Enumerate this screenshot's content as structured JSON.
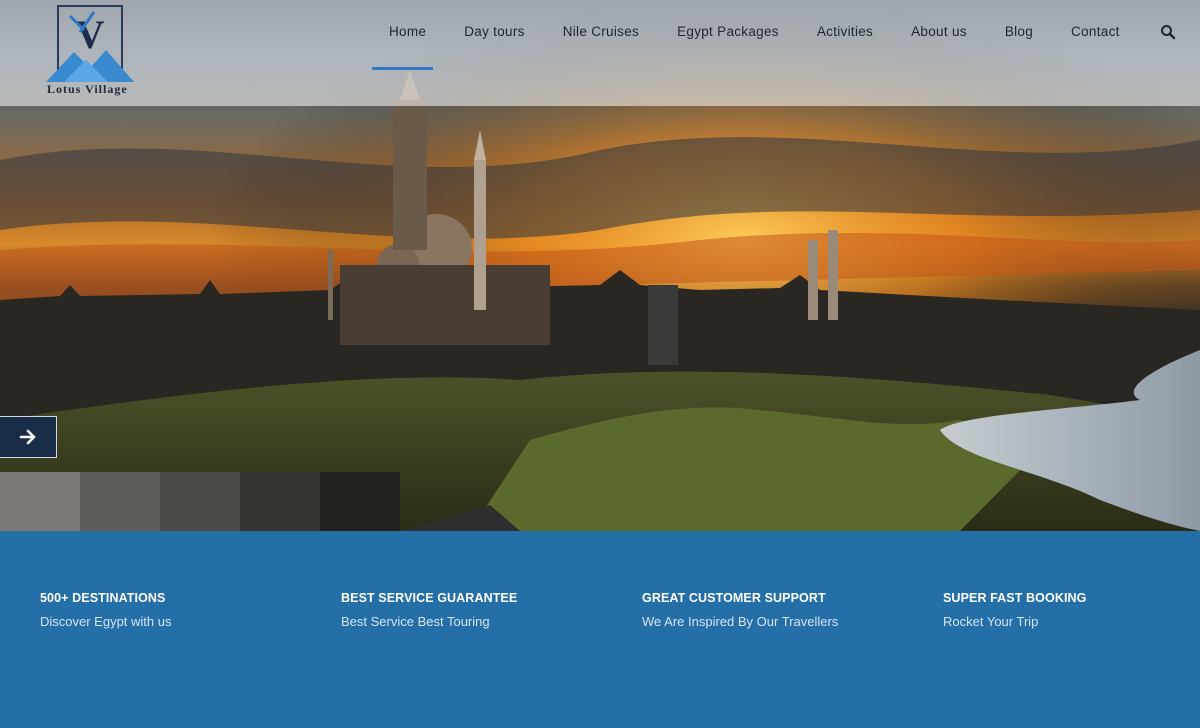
{
  "brand": {
    "logo_text": "Lotus Village",
    "logo_letter": "V"
  },
  "nav": {
    "items": [
      {
        "label": "Home",
        "active": true
      },
      {
        "label": "Day tours"
      },
      {
        "label": "Nile Cruises"
      },
      {
        "label": "Egypt Packages"
      },
      {
        "label": "Activities"
      },
      {
        "label": "About us"
      },
      {
        "label": "Blog"
      },
      {
        "label": "Contact"
      }
    ],
    "search_icon": "search-icon"
  },
  "hero": {
    "next_icon": "arrow-right-icon",
    "thumb_colors": [
      "#7d7a75",
      "#5e5d5a",
      "#4b4a46",
      "#35342f",
      "#23221e"
    ]
  },
  "features": [
    {
      "title": "500+ DESTINATIONS",
      "text": "Discover Egypt with us"
    },
    {
      "title": "BEST SERVICE GUARANTEE",
      "text": "Best Service Best Touring"
    },
    {
      "title": "GREAT CUSTOMER SUPPORT",
      "text": "We Are Inspired By Our Travellers"
    },
    {
      "title": "SUPER FAST BOOKING",
      "text": "Rocket Your Trip"
    }
  ],
  "colors": {
    "accent": "#2e78c4",
    "features_bg": "#256fa8"
  }
}
